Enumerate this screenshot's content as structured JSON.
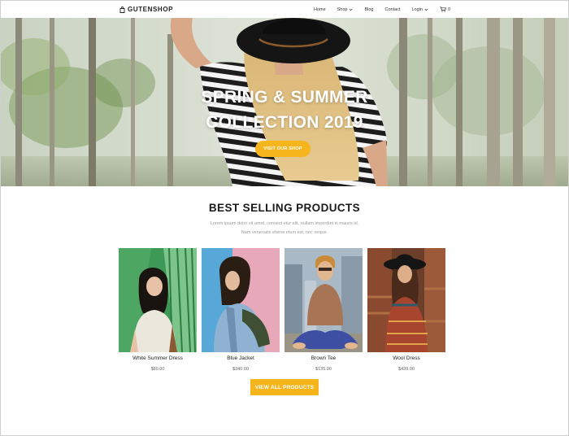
{
  "brand": {
    "name": "GUTENSHOP",
    "logo_icon": "shopping-bag-icon"
  },
  "nav": {
    "items": [
      {
        "label": "Home"
      },
      {
        "label": "Shop",
        "has_dropdown": true
      },
      {
        "label": "Blog"
      },
      {
        "label": "Contact"
      },
      {
        "label": "Login",
        "has_dropdown": true
      }
    ],
    "cart": {
      "icon": "cart-icon",
      "count": "0"
    }
  },
  "hero": {
    "title_line1": "SPRING & SUMMER",
    "title_line2": "COLLECTION 2019",
    "button_label": "VISIT OUR SHOP",
    "slides": 3,
    "active_slide": 2
  },
  "section": {
    "title": "BEST SELLING PRODUCTS",
    "subtitle_line1": "Lorem ipsum dolor sit amet, consect etur elit, nullam imperdiet in mauris id.",
    "subtitle_line2": "Nam venenatis ebene etum est, nec neque."
  },
  "products": [
    {
      "name": "White Summer Dress",
      "price": "$80.00"
    },
    {
      "name": "Blue Jacket",
      "price": "$240.00"
    },
    {
      "name": "Brown Tee",
      "price": "$135.00"
    },
    {
      "name": "Wool Dress",
      "price": "$439.00"
    }
  ],
  "view_all_label": "VIEW ALL PRODUCTS",
  "colors": {
    "accent": "#f6b51d",
    "text": "#222222",
    "muted": "#9a9a9a"
  }
}
